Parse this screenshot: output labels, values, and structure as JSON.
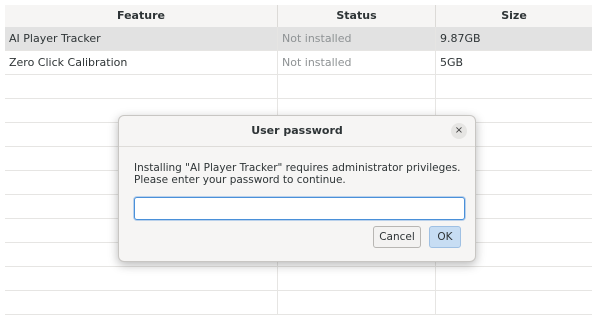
{
  "table": {
    "columns": [
      "Feature",
      "Status",
      "Size"
    ],
    "rows": [
      {
        "feature": "AI Player Tracker",
        "status": "Not installed",
        "size": "9.87GB"
      },
      {
        "feature": "Zero Click Calibration",
        "status": "Not installed",
        "size": "5GB"
      }
    ]
  },
  "dialog": {
    "title": "User password",
    "close_label": "×",
    "message_line1": "Installing \"AI Player Tracker\" requires administrator privileges.",
    "message_line2": "Please enter your password to continue.",
    "password_value": "",
    "cancel_label": "Cancel",
    "ok_label": "OK"
  }
}
